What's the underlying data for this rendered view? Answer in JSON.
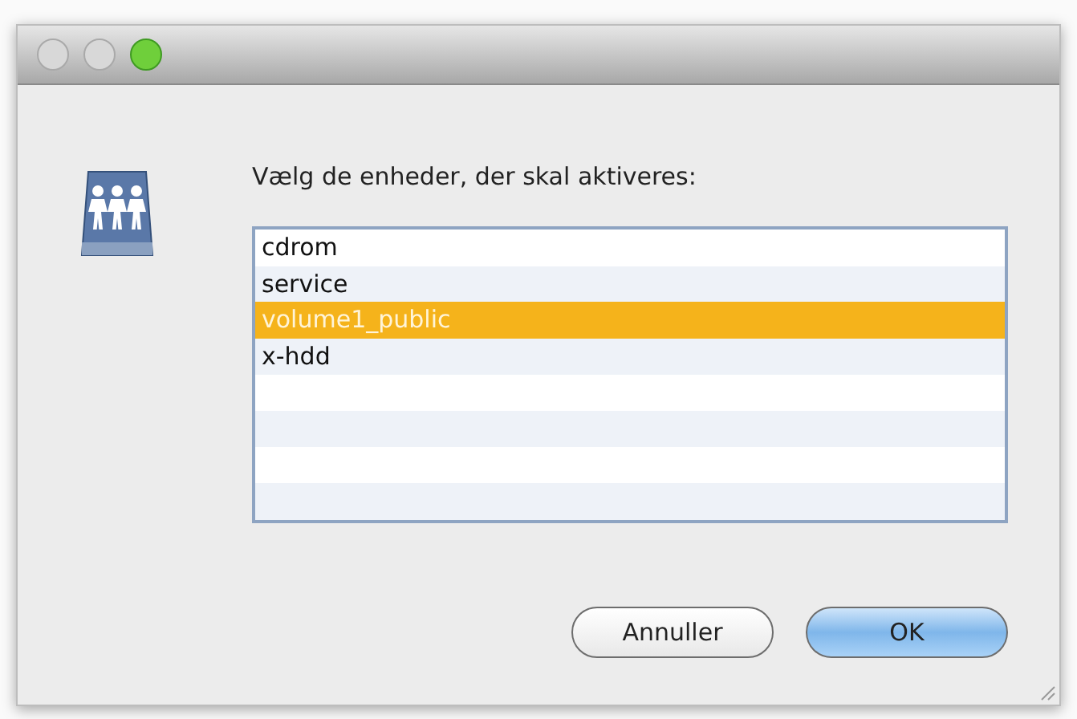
{
  "window": {
    "buttons": [
      {
        "kind": "close",
        "active": false
      },
      {
        "kind": "minimize",
        "active": false
      },
      {
        "kind": "zoom",
        "active": true
      }
    ]
  },
  "prompt": "Vælg de enheder, der skal aktiveres:",
  "list": {
    "items": [
      {
        "label": "cdrom",
        "selected": false
      },
      {
        "label": "service",
        "selected": false
      },
      {
        "label": "volume1_public",
        "selected": true
      },
      {
        "label": "x-hdd",
        "selected": false
      }
    ]
  },
  "buttons": [
    {
      "label": "Annuller",
      "default": false
    },
    {
      "label": "OK",
      "default": true
    }
  ]
}
